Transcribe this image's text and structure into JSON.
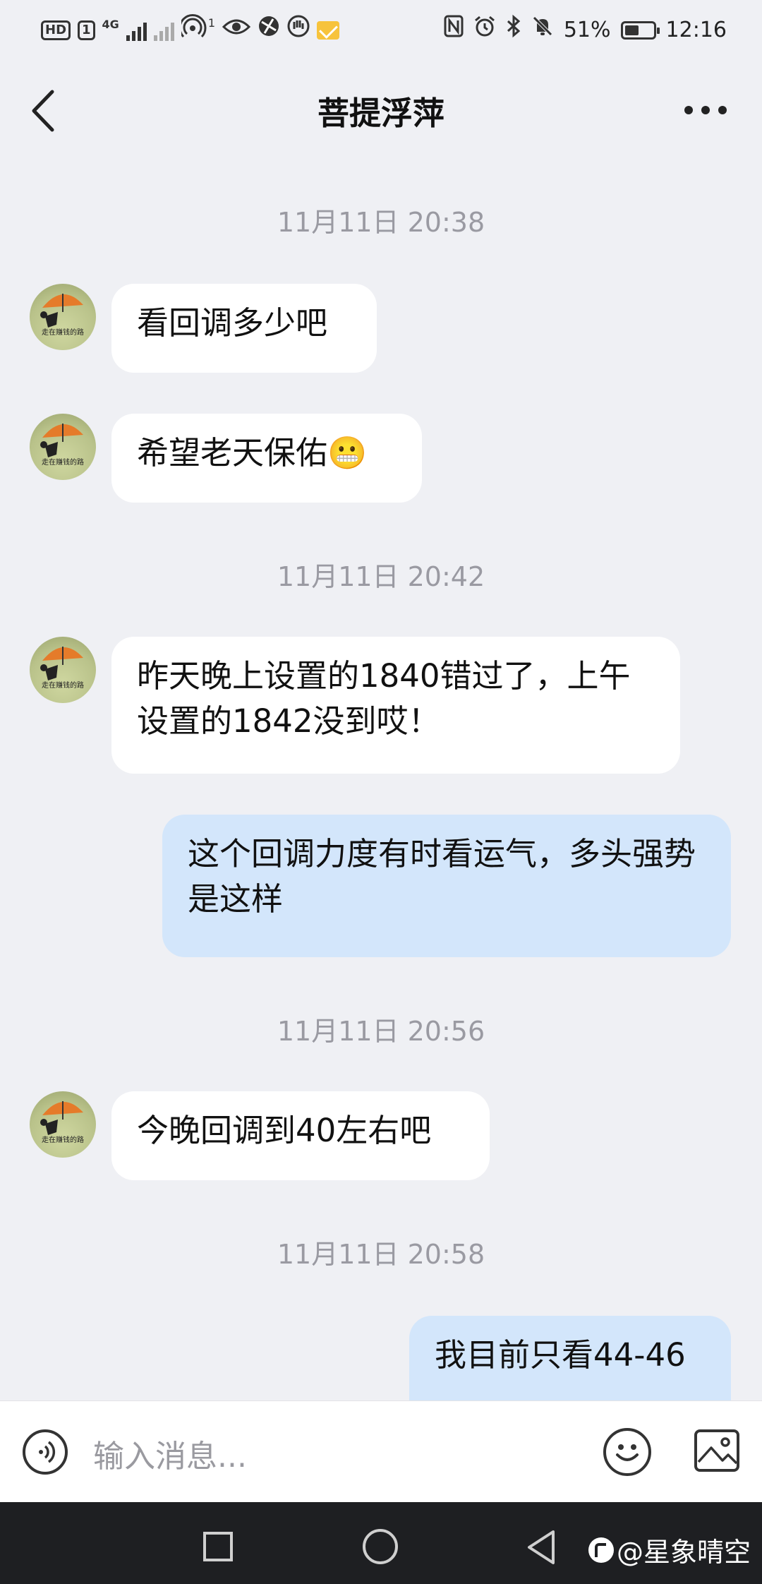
{
  "status_bar": {
    "hd_label": "HD",
    "sim_label": "1",
    "network_label": "4G",
    "hotspot_count": "1",
    "battery_text": "51%",
    "battery_level": 0.51,
    "time": "12:16",
    "icons": [
      "hd-icon",
      "sim-icon",
      "signal-icon",
      "signal-off-icon",
      "hotspot-icon",
      "eye-icon",
      "browser-icon",
      "hand-icon",
      "mail-icon",
      "nfc-icon",
      "alarm-icon",
      "bluetooth-icon",
      "mute-icon",
      "battery-icon"
    ]
  },
  "header": {
    "title": "菩提浮萍"
  },
  "messages": [
    {
      "type": "time",
      "text": "11月11日 20:38"
    },
    {
      "type": "in",
      "text": "看回调多少吧"
    },
    {
      "type": "in",
      "text": "希望老天保佑😬"
    },
    {
      "type": "time",
      "text": "11月11日 20:42"
    },
    {
      "type": "in",
      "text": "昨天晚上设置的1840错过了，上午设置的1842没到哎！"
    },
    {
      "type": "out",
      "text": "这个回调力度有时看运气，多头强势是这样"
    },
    {
      "type": "time",
      "text": "11月11日 20:56"
    },
    {
      "type": "in",
      "text": "今晚回调到40左右吧"
    },
    {
      "type": "time",
      "text": "11月11日 20:58"
    },
    {
      "type": "out",
      "text": "我目前只看44-46"
    }
  ],
  "avatar": {
    "caption": "走在赚钱的路"
  },
  "input": {
    "placeholder": "输入消息..."
  },
  "watermark": "@星象晴空",
  "colors": {
    "background": "#eff0f4",
    "incoming_bubble": "#ffffff",
    "outgoing_bubble": "#d3e6fb",
    "timestamp": "#9a9aa2",
    "navbar": "#1e1f22"
  }
}
